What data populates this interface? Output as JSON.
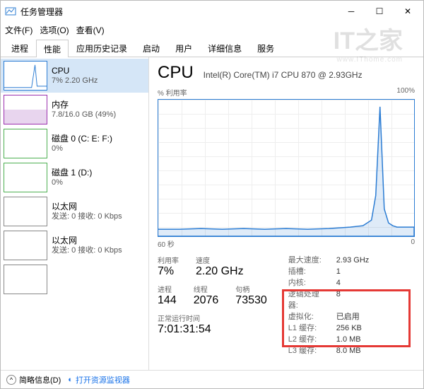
{
  "window": {
    "title": "任务管理器"
  },
  "menu": {
    "file": "文件(F)",
    "options": "选项(O)",
    "view": "查看(V)"
  },
  "tabs": [
    "进程",
    "性能",
    "应用历史记录",
    "启动",
    "用户",
    "详细信息",
    "服务"
  ],
  "sidebar": {
    "items": [
      {
        "name": "CPU",
        "sub": "7% 2.20 GHz"
      },
      {
        "name": "内存",
        "sub": "7.8/16.0 GB (49%)"
      },
      {
        "name": "磁盘 0 (C: E: F:)",
        "sub": "0%"
      },
      {
        "name": "磁盘 1 (D:)",
        "sub": "0%"
      },
      {
        "name": "以太网",
        "sub": "发送: 0 接收: 0 Kbps"
      },
      {
        "name": "以太网",
        "sub": "发送: 0 接收: 0 Kbps"
      }
    ]
  },
  "main": {
    "title": "CPU",
    "cpu_name": "Intel(R) Core(TM) i7 CPU 870 @ 2.93GHz",
    "util_label": "% 利用率",
    "util_max": "100%",
    "x_left": "60 秒",
    "x_right": "0",
    "stats": {
      "util_label": "利用率",
      "util_value": "7%",
      "speed_label": "速度",
      "speed_value": "2.20 GHz",
      "proc_label": "进程",
      "proc_value": "144",
      "thread_label": "线程",
      "thread_value": "2076",
      "handle_label": "句柄",
      "handle_value": "73530",
      "uptime_label": "正常运行时间",
      "uptime_value": "7:01:31:54"
    },
    "details": {
      "max_speed_label": "最大速度:",
      "max_speed": "2.93 GHz",
      "sockets_label": "插槽:",
      "sockets": "1",
      "cores_label": "内核:",
      "cores": "4",
      "lp_label": "逻辑处理器:",
      "lp": "8",
      "virt_label": "虚拟化:",
      "virt": "已启用",
      "l1_label": "L1 缓存:",
      "l1": "256 KB",
      "l2_label": "L2 缓存:",
      "l2": "1.0 MB",
      "l3_label": "L3 缓存:",
      "l3": "8.0 MB"
    }
  },
  "footer": {
    "fewer": "简略信息(D)",
    "monitor": "打开资源监视器"
  },
  "watermark": {
    "brand": "IT之家",
    "url": "www.IThome.com"
  },
  "chart_data": {
    "type": "line",
    "title": "% 利用率",
    "xlabel": "60 秒 → 0",
    "ylabel": "%",
    "ylim": [
      0,
      100
    ],
    "x_seconds": [
      60,
      55,
      50,
      45,
      40,
      35,
      30,
      25,
      20,
      15,
      12,
      10,
      9,
      8,
      7,
      6,
      5,
      4,
      3,
      2,
      1,
      0
    ],
    "values": [
      5,
      5,
      6,
      5,
      6,
      5,
      6,
      5,
      6,
      7,
      8,
      12,
      30,
      95,
      20,
      10,
      8,
      7,
      7,
      7,
      7,
      7
    ]
  }
}
